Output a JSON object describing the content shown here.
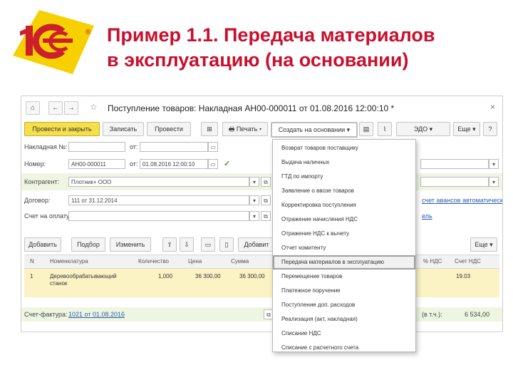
{
  "slide": {
    "title_line1": "Пример 1.1. Передача материалов",
    "title_line2": "в эксплуатацию (на основании)",
    "logo_text": "1С",
    "registered_mark": "®",
    "colors": {
      "title": "#c8102e",
      "logo_red": "#cc1f2b",
      "logo_yellow": "#f6d000",
      "primary_button": "#f5df4d"
    }
  },
  "window": {
    "nav_home": "⌂",
    "nav_back": "←",
    "nav_forward": "→",
    "fav": "☆",
    "title": "Поступление товаров: Накладная АН00-000011 от 01.08.2016 12:00:10 *",
    "close": "×"
  },
  "toolbar": {
    "post_close": "Провести и закрыть",
    "save": "Записать",
    "post": "Провести",
    "print": "Печать",
    "create_based": "Создать на основании",
    "edo": "ЭДО",
    "more": "Еще",
    "help": "?"
  },
  "form": {
    "invoice_no_label": "Накладная №:",
    "invoice_from_label": "от:",
    "number_label": "Номер:",
    "number_value": "АН00-000011",
    "number_from_label": "от:",
    "date_value": "01.08.2016 12:00:10",
    "counterparty_label": "Контрагент:",
    "counterparty_value": "Плотник+ ООО",
    "contract_label": "Договор:",
    "contract_value": "111 от 31.12.2014",
    "bill_label": "Счет на оплату:",
    "vat_auto": "счет авансов автоматически",
    "vat_link_tail": "ель"
  },
  "table": {
    "add": "Добавить",
    "pick": "Подбор",
    "change": "Изменить",
    "add2": "Добавит",
    "more": "Еще",
    "columns": [
      "N",
      "Номенклатура",
      "Количество",
      "Цена",
      "Сумма",
      "% НДС",
      "Счет НДС"
    ],
    "rows": [
      {
        "n": "1",
        "name1": "Деревообрабатывающий",
        "name2": "станок",
        "qty": "1,000",
        "price": "36 300,00",
        "sum": "36 300,00",
        "vat_account": "19.03"
      }
    ]
  },
  "footer": {
    "invoice_label": "Счет-фактура:",
    "invoice_link": "1021 от 01.08.2016",
    "total_label": "(в т.ч.):",
    "total_value": "6 534,00"
  },
  "dropdown": {
    "items": [
      "Возврат товаров поставщику",
      "Выдача наличных",
      "ГТД по импорту",
      "Заявление о ввозе товаров",
      "Корректировка поступления",
      "Отражение начисления НДС",
      "Отражение НДС к вычету",
      "Отчет комитенту",
      "Передача материалов в эксплуатацию",
      "Перемещение товаров",
      "Платежное поручение",
      "Поступление доп. расходов",
      "Реализация (акт, накладная)",
      "Списание НДС",
      "Списание с расчетного счета"
    ],
    "selected_index": 8
  }
}
